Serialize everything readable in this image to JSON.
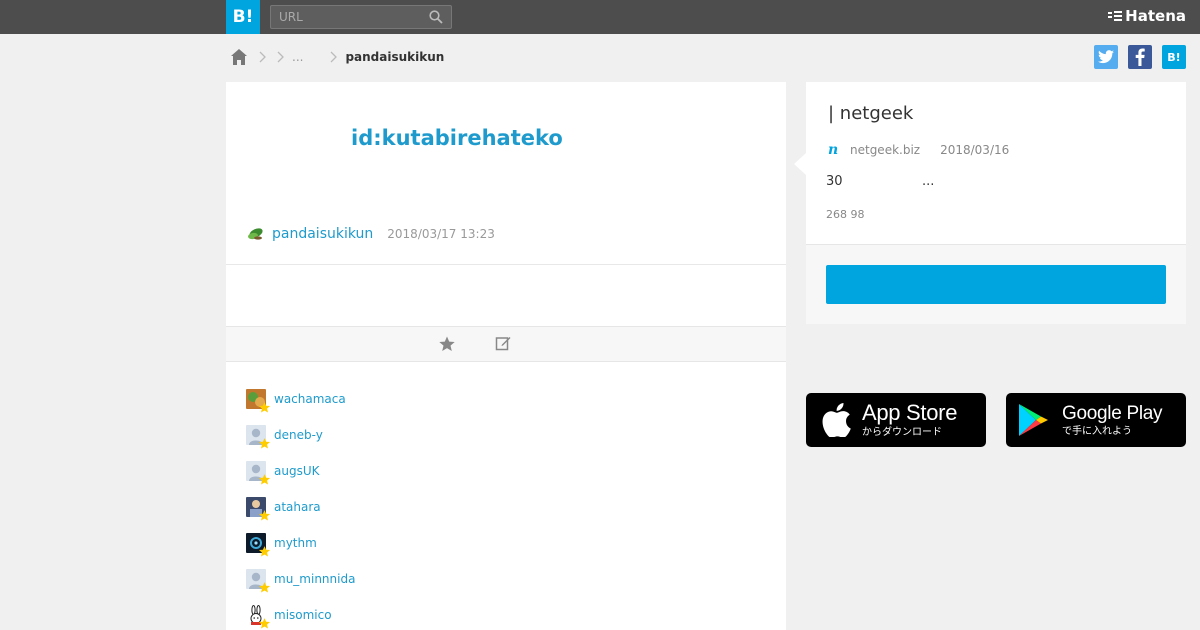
{
  "topbar": {
    "logo": "B!",
    "search_placeholder": "URL",
    "brand": "Hatena"
  },
  "breadcrumb": {
    "ellipsis": "...",
    "current": "pandaisukikun"
  },
  "share": {
    "twitter": "t",
    "facebook": "f",
    "hatena": "B!"
  },
  "main": {
    "title_user": "id:kutabirehateko",
    "author": "pandaisukikun",
    "date": "2018/03/17 13:23",
    "stars": [
      {
        "name": "wachamaca",
        "avatar": "photo"
      },
      {
        "name": "deneb-y",
        "avatar": "default"
      },
      {
        "name": "augsUK",
        "avatar": "default"
      },
      {
        "name": "atahara",
        "avatar": "photo"
      },
      {
        "name": "mythm",
        "avatar": "photo"
      },
      {
        "name": "mu_minnnida",
        "avatar": "default"
      },
      {
        "name": "misomico",
        "avatar": "bunny"
      }
    ]
  },
  "side": {
    "title": "| netgeek",
    "domain": "netgeek.biz",
    "date": "2018/03/16",
    "excerpt_a": "30",
    "excerpt_b": "...",
    "counts": "268 98"
  },
  "badges": {
    "appstore_main": "App Store",
    "appstore_sub": "からダウンロード",
    "play_main": "Google Play",
    "play_sub": "で手に入れよう"
  },
  "colors": {
    "accent": "#00a4de",
    "link": "#1e9bcc",
    "topbar": "#4d4d4d",
    "star": "#ffcc00"
  }
}
